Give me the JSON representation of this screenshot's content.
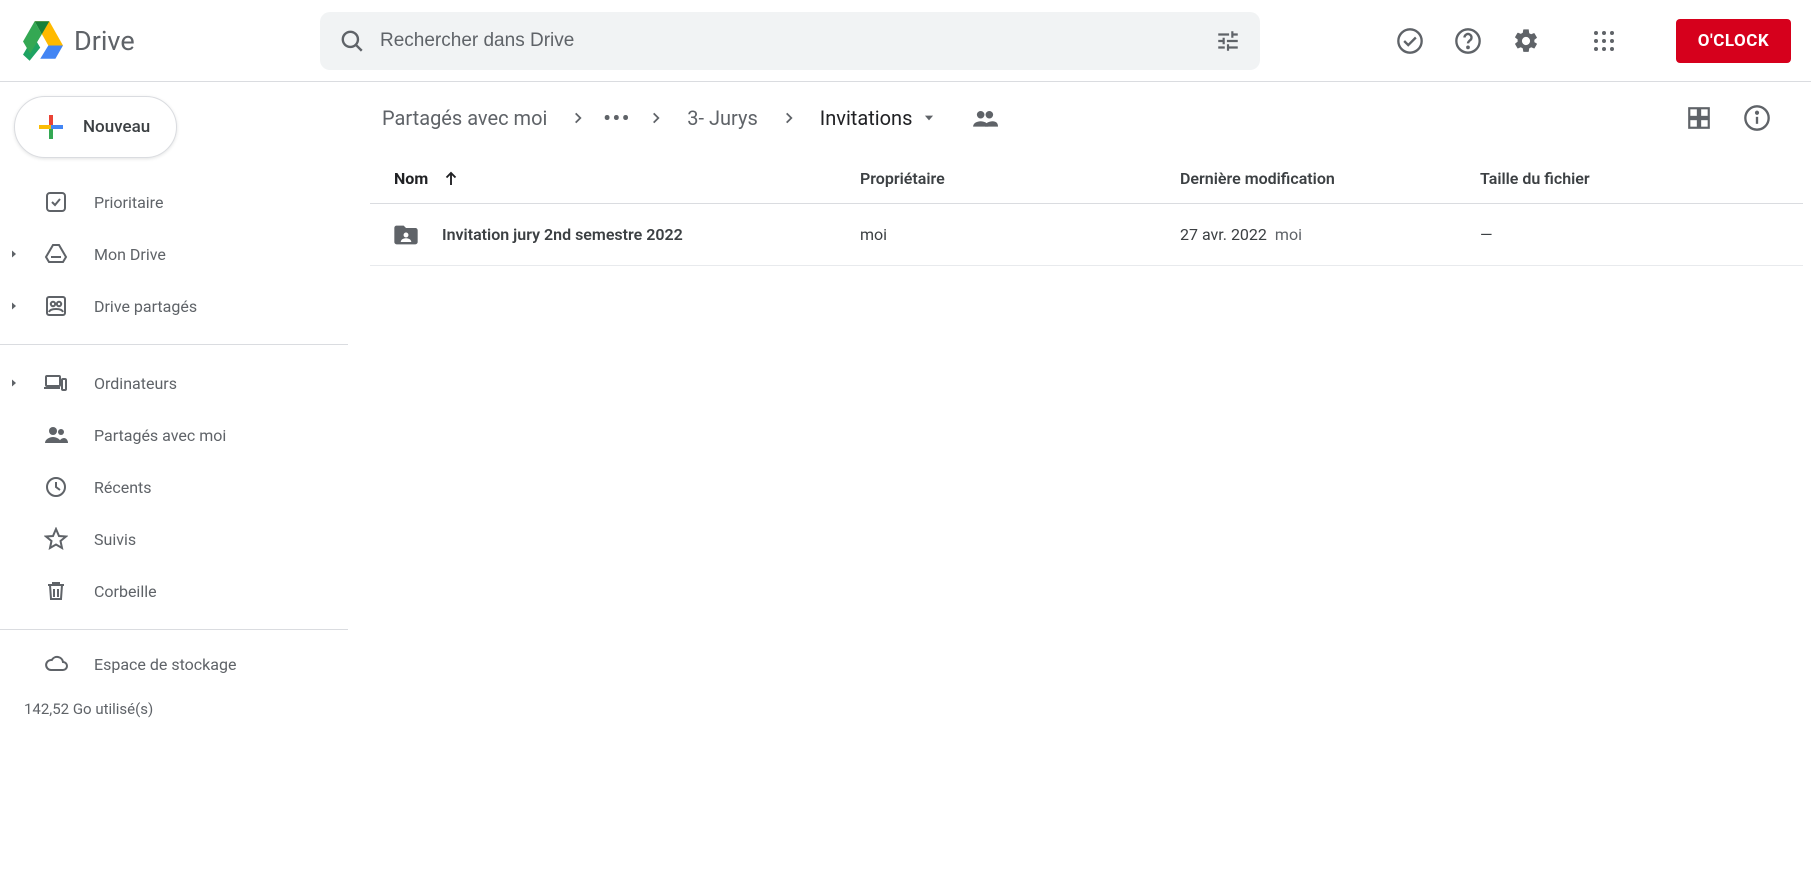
{
  "header": {
    "app_name": "Drive",
    "search_placeholder": "Rechercher dans Drive",
    "oclock_label": "O'CLOCK"
  },
  "sidebar": {
    "new_label": "Nouveau",
    "items": [
      {
        "icon": "priority",
        "label": "Prioritaire",
        "expandable": false
      },
      {
        "icon": "mydrive",
        "label": "Mon Drive",
        "expandable": true
      },
      {
        "icon": "shareddrives",
        "label": "Drive partagés",
        "expandable": true
      }
    ],
    "items2": [
      {
        "icon": "computers",
        "label": "Ordinateurs",
        "expandable": true
      },
      {
        "icon": "shared",
        "label": "Partagés avec moi",
        "expandable": false
      },
      {
        "icon": "recent",
        "label": "Récents",
        "expandable": false
      },
      {
        "icon": "starred",
        "label": "Suivis",
        "expandable": false
      },
      {
        "icon": "trash",
        "label": "Corbeille",
        "expandable": false
      }
    ],
    "storage": {
      "label": "Espace de stockage",
      "usage": "142,52 Go utilisé(s)"
    }
  },
  "breadcrumbs": {
    "root": "Partagés avec moi",
    "mid": "3- Jurys",
    "current": "Invitations"
  },
  "table": {
    "columns": {
      "name": "Nom",
      "owner": "Propriétaire",
      "modified": "Dernière modification",
      "size": "Taille du fichier"
    },
    "rows": [
      {
        "name": "Invitation jury 2nd semestre 2022",
        "owner": "moi",
        "modified_date": "27 avr. 2022",
        "modified_by": "moi",
        "size": "—"
      }
    ]
  }
}
